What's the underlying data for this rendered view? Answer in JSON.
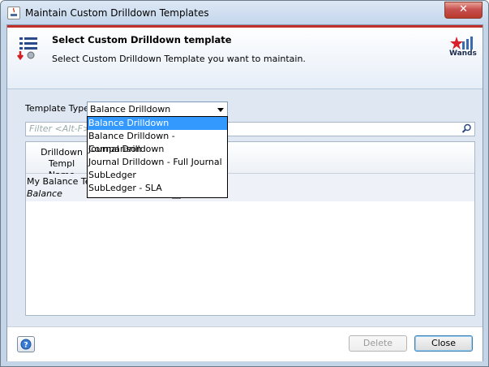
{
  "window": {
    "title": "Maintain Custom Drilldown Templates",
    "close_glyph": "✕"
  },
  "header": {
    "title": "Select Custom Drilldown template",
    "subtitle": "Select Custom Drilldown Template you want to maintain.",
    "brand_label": "Wands",
    "icon": "template-list-icon",
    "accent_color": "#c0302a"
  },
  "form": {
    "template_type_label": "Template Type",
    "template_type_value": "Balance Drilldown",
    "filter_placeholder": "Filter <Alt-F>"
  },
  "dropdown": {
    "options": [
      "Balance Drilldown",
      "Balance Drilldown - Comparison",
      "Journal Drilldown",
      "Journal Drilldown - Full Journal",
      "SubLedger",
      "SubLedger - SLA"
    ],
    "selected_index": 0,
    "selected_color": "#3399ff"
  },
  "table": {
    "header_line1": "Drilldown Templ",
    "header_line2": "Name",
    "rows": [
      {
        "name": "My Balance Tem",
        "type": "Balance"
      }
    ]
  },
  "footer": {
    "help_icon": "help-icon",
    "delete_label": "Delete",
    "close_label": "Close"
  }
}
